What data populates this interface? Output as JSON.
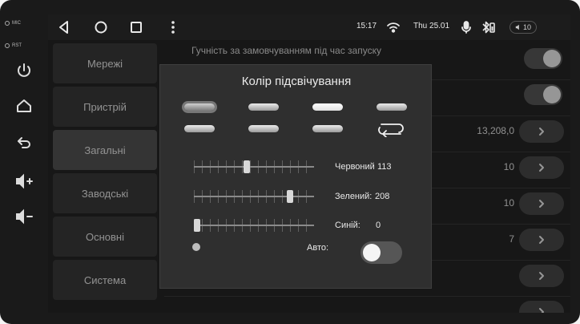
{
  "hardware": {
    "mic_label": "MIC",
    "rst_label": "RST",
    "buttons": [
      "power-icon",
      "home-icon",
      "back-icon",
      "volume-up-icon",
      "volume-down-icon"
    ]
  },
  "statusbar": {
    "nav_icons": [
      "back-triangle-icon",
      "home-circle-icon",
      "recents-square-icon",
      "more-vert-icon"
    ],
    "time": "15:17",
    "date": "Thu 25.01",
    "volume": "10"
  },
  "sidebar": {
    "items": [
      {
        "label": "Мережі",
        "active": false
      },
      {
        "label": "Пристрій",
        "active": false
      },
      {
        "label": "Загальні",
        "active": true
      },
      {
        "label": "Заводські",
        "active": false
      },
      {
        "label": "Основні",
        "active": false
      },
      {
        "label": "Система",
        "active": false
      }
    ]
  },
  "settings": {
    "rows": [
      {
        "label": "Гучність за замовчуванням під час запуску",
        "control": "toggle"
      },
      {
        "label": "",
        "control": "toggle"
      },
      {
        "label": "",
        "value": "13,208,0",
        "control": "arrow"
      },
      {
        "label": "",
        "value": "10",
        "control": "arrow"
      },
      {
        "label": "",
        "value": "10",
        "control": "arrow"
      },
      {
        "label": "",
        "value": "7",
        "control": "arrow"
      },
      {
        "label": "",
        "control": "arrow"
      },
      {
        "label": "",
        "value": "",
        "control": "arrow"
      }
    ]
  },
  "dialog": {
    "title": "Колір підсвічування",
    "red_label": "Червоний",
    "red_value": "113",
    "green_label": "Зелений:",
    "green_value": "208",
    "blue_label": "Синій:",
    "blue_value": "0",
    "red_level": 0.44,
    "green_level": 0.82,
    "blue_level": 0.0,
    "auto_label": "Авто:",
    "auto_on": false
  }
}
